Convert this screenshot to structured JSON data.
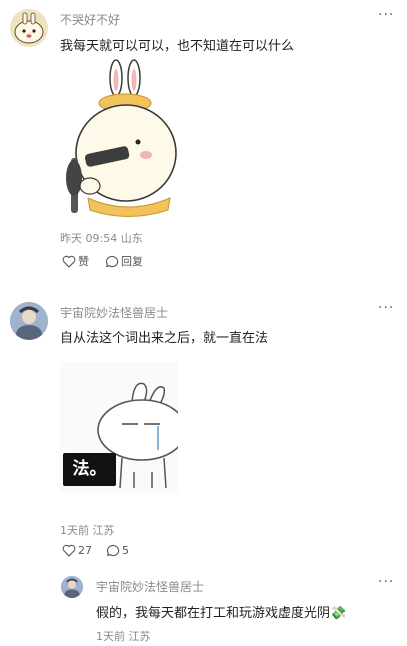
{
  "comments": [
    {
      "username": "不哭好不好",
      "text": "我每天就可以可以，也不知道在可以什么",
      "meta": "昨天 09:54 山东",
      "like_label": "赞",
      "reply_label": "回复"
    },
    {
      "username": "宇宙院妙法怪兽居士",
      "text": "自从法这个词出来之后，就一直在法",
      "sticker_caption": "法。",
      "meta": "1天前 江苏",
      "like_count": "27",
      "reply_count": "5"
    }
  ],
  "reply": {
    "username": "宇宙院妙法怪兽居士",
    "text": "假的，我每天都在打工和玩游戏虚度光阴",
    "emoji": "💸",
    "meta": "1天前 江苏"
  },
  "icons": {
    "more": "more-icon",
    "like": "heart-icon",
    "reply": "comment-bubble-icon"
  },
  "colors": {
    "username": "#8a8a8a",
    "meta": "#8a8a8a",
    "text": "#1f1f1f"
  }
}
